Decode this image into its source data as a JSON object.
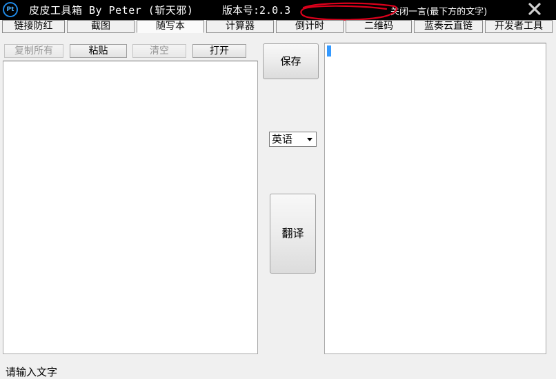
{
  "titlebar": {
    "logo_text": "Pt",
    "title": "皮皮工具箱 By Peter (斩天邪)",
    "version": "版本号:2.0.3",
    "quote_toggle": "关闭一言(最下方的文字)",
    "close_icon": "close-x-icon",
    "redaction_color": "#d9001b"
  },
  "tabs": [
    {
      "label": "链接防红"
    },
    {
      "label": "截图"
    },
    {
      "label": "随写本",
      "active": true
    },
    {
      "label": "计算器"
    },
    {
      "label": "倒计时"
    },
    {
      "label": "二维码"
    },
    {
      "label": "蓝奏云直链"
    },
    {
      "label": "开发者工具"
    }
  ],
  "toolbar": {
    "copy_all": "复制所有",
    "paste": "粘贴",
    "clear": "清空",
    "open": "打开"
  },
  "actions": {
    "save": "保存",
    "translate": "翻译"
  },
  "language_select": {
    "selected": "英语"
  },
  "input_text": {
    "value": ""
  },
  "output_text": {
    "value": ""
  },
  "status": {
    "text": "请输入文字"
  },
  "colors": {
    "titlebar_bg": "#000000",
    "caret": "#3399ff",
    "logo_ring": "#1e88e5"
  }
}
